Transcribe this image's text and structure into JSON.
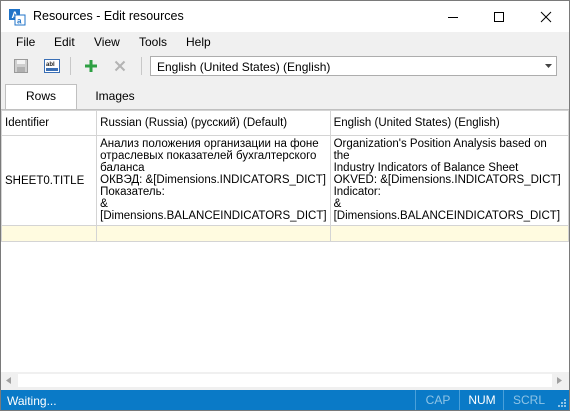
{
  "window": {
    "title": "Resources - Edit resources"
  },
  "menu": {
    "items": [
      {
        "label": "File"
      },
      {
        "label": "Edit"
      },
      {
        "label": "View"
      },
      {
        "label": "Tools"
      },
      {
        "label": "Help"
      }
    ]
  },
  "toolbar": {
    "icons": [
      "save-icon",
      "text-resource-icon",
      "add-icon",
      "delete-icon"
    ],
    "language_select": {
      "selected": "English (United States) (English)"
    }
  },
  "tabs": [
    {
      "label": "Rows",
      "active": true
    },
    {
      "label": "Images",
      "active": false
    }
  ],
  "grid": {
    "columns": [
      {
        "label": "Identifier"
      },
      {
        "label": "Russian (Russia) (русский) (Default)"
      },
      {
        "label": "English (United States) (English)"
      }
    ],
    "rows": [
      {
        "identifier": "SHEET0.TITLE",
        "russian": "Анализ положения организации на фоне\nотраслевых показателей бухгалтерского\nбаланса\nОКВЭД: &[Dimensions.INDICATORS_DICT]\nПоказатель:\n&[Dimensions.BALANCEINDICATORS_DICT]",
        "english": "Organization's Position Analysis based on the\nIndustry Indicators of Balance Sheet\nOKVED: &[Dimensions.INDICATORS_DICT]\nIndicator:\n&[Dimensions.BALANCEINDICATORS_DICT]"
      }
    ]
  },
  "status": {
    "text": "Waiting...",
    "indicators": [
      {
        "label": "CAP",
        "active": false
      },
      {
        "label": "NUM",
        "active": true
      },
      {
        "label": "SCRL",
        "active": false
      }
    ]
  },
  "colors": {
    "statusbar": "#0a7ac7",
    "new_row": "#fffbe0",
    "add_icon": "#2ea043"
  }
}
